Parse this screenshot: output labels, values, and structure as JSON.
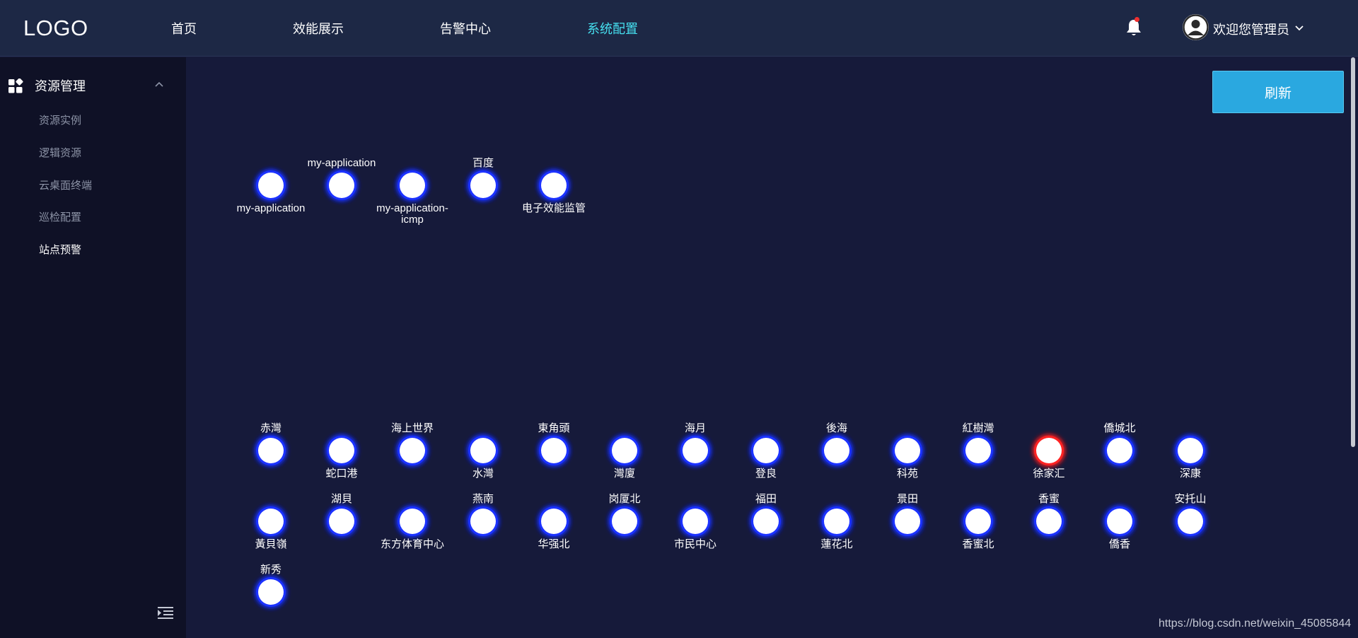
{
  "header": {
    "logo": "LOGO",
    "nav": [
      "首页",
      "效能展示",
      "告警中心",
      "系统配置"
    ],
    "active_nav": 3,
    "user_name": "欢迎您管理员",
    "accent_color": "#46e0f0"
  },
  "sidebar": {
    "group_label": "资源管理",
    "items": [
      "资源实例",
      "逻辑资源",
      "云桌面终端",
      "巡检配置",
      "站点预警"
    ],
    "active_item": 4
  },
  "main": {
    "refresh_label": "刷新",
    "watermark": "https://blog.csdn.net/weixin_45085844"
  },
  "graph": {
    "link_color": "#f2b8c8",
    "node_glow_color": "#1a33ff",
    "alert_glow_color": "#ff2020",
    "rows": [
      {
        "nodes": [
          {
            "name": "my-application",
            "label_pos": "below"
          },
          {
            "name": "my-application",
            "label_pos": "above"
          },
          {
            "name": "my-application-icmp",
            "label_pos": "below",
            "wrap": [
              "my-application-",
              "icmp"
            ]
          },
          {
            "name": "百度",
            "label_pos": "above"
          },
          {
            "name": "电子效能监管",
            "label_pos": "below"
          }
        ]
      },
      {
        "nodes": [
          {
            "name": "赤灣",
            "label_pos": "above"
          },
          {
            "name": "蛇口港",
            "label_pos": "below"
          },
          {
            "name": "海上世界",
            "label_pos": "above"
          },
          {
            "name": "水灣",
            "label_pos": "below"
          },
          {
            "name": "東角頭",
            "label_pos": "above"
          },
          {
            "name": "灣廈",
            "label_pos": "below"
          },
          {
            "name": "海月",
            "label_pos": "above"
          },
          {
            "name": "登良",
            "label_pos": "below"
          },
          {
            "name": "後海",
            "label_pos": "above"
          },
          {
            "name": "科苑",
            "label_pos": "below"
          },
          {
            "name": "紅樹灣",
            "label_pos": "above"
          },
          {
            "name": "徐家汇",
            "label_pos": "below",
            "alert": true
          },
          {
            "name": "僑城北",
            "label_pos": "above"
          },
          {
            "name": "深康",
            "label_pos": "below"
          }
        ]
      },
      {
        "nodes": [
          {
            "name": "黃貝嶺",
            "label_pos": "below"
          },
          {
            "name": "湖貝",
            "label_pos": "above"
          },
          {
            "name": "东方体育中心",
            "label_pos": "below"
          },
          {
            "name": "燕南",
            "label_pos": "above"
          },
          {
            "name": "华强北",
            "label_pos": "below"
          },
          {
            "name": "岗厦北",
            "label_pos": "above"
          },
          {
            "name": "市民中心",
            "label_pos": "below"
          },
          {
            "name": "福田",
            "label_pos": "above"
          },
          {
            "name": "蓮花北",
            "label_pos": "below"
          },
          {
            "name": "景田",
            "label_pos": "above"
          },
          {
            "name": "香蜜北",
            "label_pos": "below"
          },
          {
            "name": "香蜜",
            "label_pos": "above"
          },
          {
            "name": "僑香",
            "label_pos": "below"
          },
          {
            "name": "安托山",
            "label_pos": "above"
          }
        ]
      },
      {
        "nodes": [
          {
            "name": "新秀",
            "label_pos": "above"
          }
        ]
      }
    ]
  }
}
